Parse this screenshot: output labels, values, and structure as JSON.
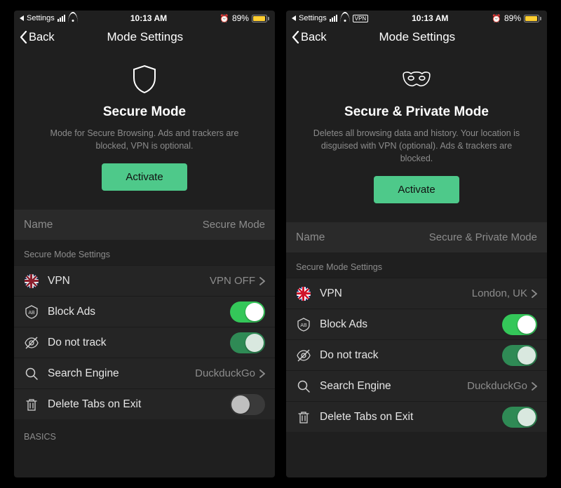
{
  "screens": [
    {
      "status": {
        "carrier": "Settings",
        "show_vpn": false,
        "time": "10:13 AM",
        "battery_pct": 89,
        "battery_label": "89%"
      },
      "nav": {
        "back": "Back",
        "title": "Mode Settings"
      },
      "hero": {
        "icon": "shield",
        "title": "Secure Mode",
        "desc": "Mode for Secure Browsing. Ads and trackers are blocked, VPN is optional.",
        "activate": "Activate"
      },
      "name_row": {
        "label": "Name",
        "value": "Secure Mode"
      },
      "section_header": "Secure Mode Settings",
      "rows": [
        {
          "icon": "flag-uk-dim",
          "label": "VPN",
          "value": "VPN OFF",
          "chevron": true
        },
        {
          "icon": "ab-badge",
          "label": "Block Ads",
          "toggle": "on"
        },
        {
          "icon": "eye-off",
          "label": "Do not track",
          "toggle": "on-dim"
        },
        {
          "icon": "magnifier",
          "label": "Search Engine",
          "value": "DuckduckGo",
          "chevron": true
        },
        {
          "icon": "trash",
          "label": "Delete Tabs on Exit",
          "toggle": "off"
        }
      ],
      "footer_header": "BASICS"
    },
    {
      "status": {
        "carrier": "Settings",
        "show_vpn": true,
        "vpn_label": "VPN",
        "time": "10:13 AM",
        "battery_pct": 89,
        "battery_label": "89%"
      },
      "nav": {
        "back": "Back",
        "title": "Mode Settings"
      },
      "hero": {
        "icon": "mask",
        "title": "Secure & Private Mode",
        "desc": "Deletes all browsing data and history. Your location is disguised with VPN (optional). Ads & trackers are blocked.",
        "activate": "Activate"
      },
      "name_row": {
        "label": "Name",
        "value": "Secure & Private Mode"
      },
      "section_header": "Secure Mode Settings",
      "rows": [
        {
          "icon": "flag-uk",
          "label": "VPN",
          "value": "London, UK",
          "chevron": true
        },
        {
          "icon": "ab-badge",
          "label": "Block Ads",
          "toggle": "on"
        },
        {
          "icon": "eye-off",
          "label": "Do not track",
          "toggle": "on-dim"
        },
        {
          "icon": "magnifier",
          "label": "Search Engine",
          "value": "DuckduckGo",
          "chevron": true
        },
        {
          "icon": "trash",
          "label": "Delete Tabs on Exit",
          "toggle": "on-dim"
        }
      ]
    }
  ]
}
